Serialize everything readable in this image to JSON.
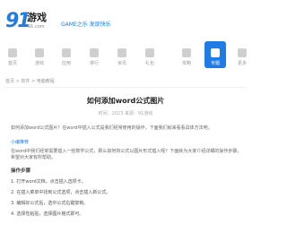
{
  "header": {
    "logo_mark": "91",
    "logo_word": "游戏",
    "logo_sub": "91.com",
    "slogan": "GAME之乐  发现快乐"
  },
  "nav": {
    "items": [
      {
        "label": "首页"
      },
      {
        "label": "游戏"
      },
      {
        "label": "应用"
      },
      {
        "label": "排行"
      },
      {
        "label": "资讯"
      },
      {
        "label": "礼包"
      },
      {
        "label": "攻略"
      },
      {
        "label": "专题"
      },
      {
        "label": "更多"
      }
    ],
    "active_index": 7
  },
  "breadcrumb": "首页 > 软件 > 电脑教程",
  "article": {
    "title": "如何添加word公式图片",
    "meta": "时间：2023 来源：91游戏",
    "intro": "如何添加word公式图片？在word中插入公式是我们经常使用的操作，下面我们就来看看具体方法吧。",
    "intro_link": "小编推荐",
    "body": "在word中我们经常需要插入一些数学公式，那么如何将公式以图片形式插入呢？下面就为大家介绍详细的操作步骤，希望对大家有所帮助。",
    "section_head": "操作步骤",
    "steps": [
      "1. 打开word文档，点击插入选项卡。",
      "2. 在插入菜单中找到公式选项，点击插入新公式。",
      "3. 编辑好公式后，选中公式右键复制。",
      "4. 选择性粘贴，选择图片格式即可。"
    ]
  }
}
